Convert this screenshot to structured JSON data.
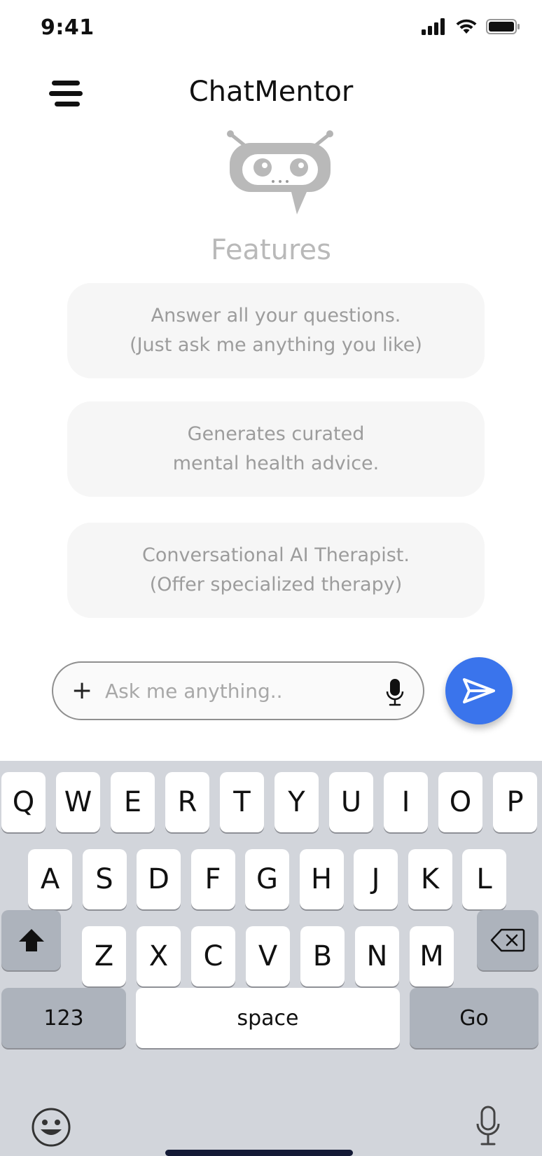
{
  "status": {
    "time": "9:41"
  },
  "header": {
    "title": "ChatMentor"
  },
  "features": {
    "title": "Features",
    "cards": [
      {
        "line1": "Answer all your questions.",
        "line2": "(Just ask me anything you like)"
      },
      {
        "line1": "Generates curated",
        "line2": "mental health advice."
      },
      {
        "line1": "Conversational AI Therapist.",
        "line2": "(Offer specialized therapy)"
      }
    ]
  },
  "composer": {
    "placeholder": "Ask me anything..",
    "plus": "+"
  },
  "keyboard": {
    "row1": [
      "Q",
      "W",
      "E",
      "R",
      "T",
      "Y",
      "U",
      "I",
      "O",
      "P"
    ],
    "row2": [
      "A",
      "S",
      "D",
      "F",
      "G",
      "H",
      "J",
      "K",
      "L"
    ],
    "row3": [
      "Z",
      "X",
      "C",
      "V",
      "B",
      "N",
      "M"
    ],
    "numbers": "123",
    "space": "space",
    "go": "Go"
  },
  "colors": {
    "accent": "#3a74ec",
    "keyboard_bg": "#d2d5db",
    "card_bg": "#f6f6f6"
  }
}
